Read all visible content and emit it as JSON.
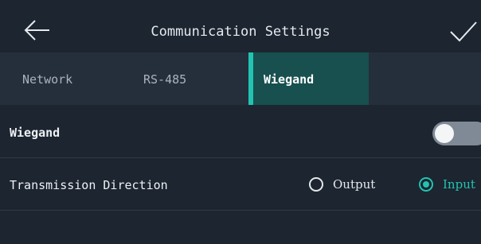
{
  "header": {
    "title": "Communication Settings",
    "back_icon": "arrow-left-icon",
    "confirm_icon": "checkmark-icon"
  },
  "tabs": [
    {
      "label": "Network",
      "active": false
    },
    {
      "label": "RS-485",
      "active": false
    },
    {
      "label": "Wiegand",
      "active": true
    }
  ],
  "settings": {
    "wiegand": {
      "label": "Wiegand",
      "enabled": false
    },
    "transmission_direction": {
      "label": "Transmission Direction",
      "options": [
        {
          "label": "Output",
          "selected": false
        },
        {
          "label": "Input",
          "selected": true
        }
      ]
    }
  },
  "colors": {
    "background": "#1c2530",
    "tab_bar": "#252f3b",
    "active_tab": "#17504f",
    "accent": "#22c3b0",
    "toggle_off": "#7f8a96"
  }
}
